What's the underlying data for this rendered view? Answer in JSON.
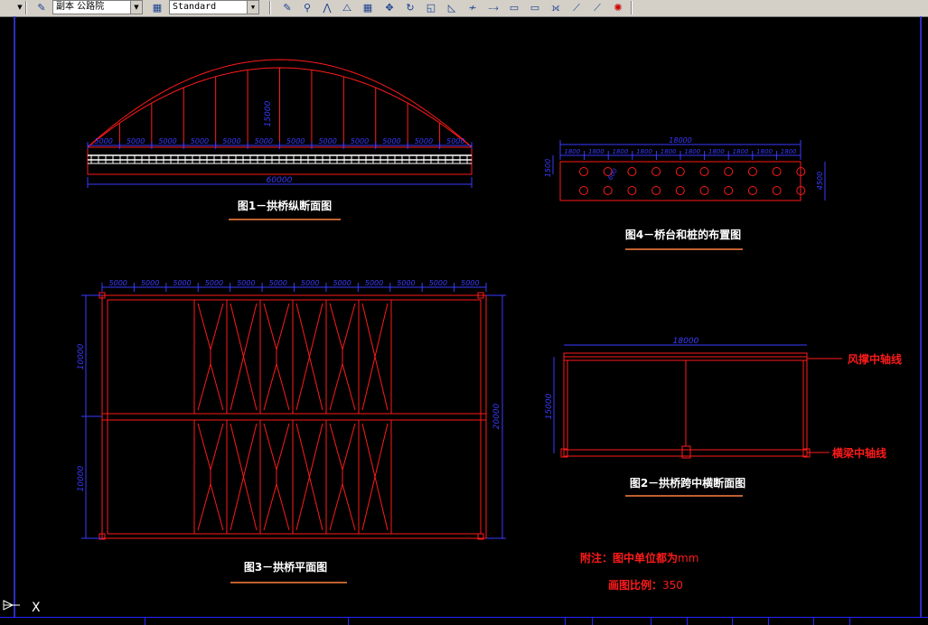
{
  "toolbar": {
    "layer_combo": "副本 公路院",
    "style_combo": "Standard",
    "colors": {
      "bg": "#d4d0c8"
    }
  },
  "drawing": {
    "fig1": {
      "title": "图1－拱桥纵断面图",
      "dims": [
        "5000",
        "5000",
        "5000",
        "5000",
        "5000",
        "5000",
        "5000",
        "5000",
        "5000",
        "5000",
        "5000",
        "5000"
      ],
      "total": "60000",
      "rise": "15000"
    },
    "fig2": {
      "title": "图2－拱桥跨中横断面图",
      "width_dim": "18000",
      "height_dim": "15000",
      "label_top": "风撑中轴线",
      "label_bottom": "横梁中轴线"
    },
    "fig3": {
      "title": "图3－拱桥平面图",
      "dims": [
        "5000",
        "5000",
        "5000",
        "5000",
        "5000",
        "5000",
        "5000",
        "5000",
        "5000",
        "5000",
        "5000",
        "5000"
      ],
      "left_top": "10000",
      "left_bottom": "10000",
      "right": "20000"
    },
    "fig4": {
      "title": "图4－桥台和桩的布置图",
      "total": "18000",
      "dims": [
        "1800",
        "1800",
        "1800",
        "1800",
        "1800",
        "1800",
        "1800",
        "1800",
        "1800",
        "1800"
      ],
      "left_dim": "1500",
      "right_dim": "4500",
      "pile_dim": "600"
    },
    "notes": {
      "line1_prefix": "附注：图中单位都为",
      "line1_unit": "mm",
      "line2_prefix": "画图比例：",
      "line2_value": "350"
    },
    "ucs_label": "X",
    "colors": {
      "bg": "#000000",
      "red": "#ff1a1a",
      "blue": "#3a3aff",
      "white": "#ffffff",
      "orange": "#ff8040"
    }
  }
}
